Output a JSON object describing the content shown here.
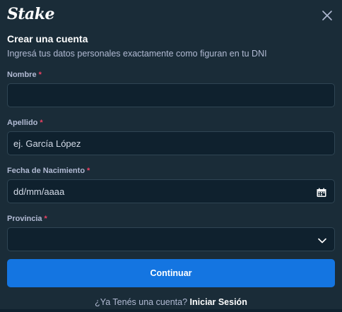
{
  "header": {
    "logo": "Stake"
  },
  "form": {
    "title": "Crear una cuenta",
    "subtitle": "Ingresá tus datos personales exactamente como figuran en tu DNI",
    "required_mark": "*",
    "fields": [
      {
        "label": "Nombre",
        "value": "",
        "placeholder": ""
      },
      {
        "label": "Apellido",
        "value": "",
        "placeholder": "ej. García López"
      },
      {
        "label": "Fecha de Nacimiento",
        "value": "",
        "placeholder": "dd/mm/aaaa"
      },
      {
        "label": "Provincia",
        "value": "",
        "placeholder": ""
      }
    ],
    "submit_label": "Continuar"
  },
  "footer": {
    "prompt": "¿Ya Tenés una cuenta?",
    "link": "Iniciar Sesión"
  },
  "colors": {
    "background": "#1a2c38",
    "input_background": "#0f212e",
    "input_border": "#2f4553",
    "primary_button": "#1475e1",
    "required": "#ed4163",
    "muted_text": "#b1bad3"
  },
  "icons": {
    "close": "close-icon",
    "calendar": "calendar-icon",
    "dropdown": "chevron-down-icon"
  }
}
